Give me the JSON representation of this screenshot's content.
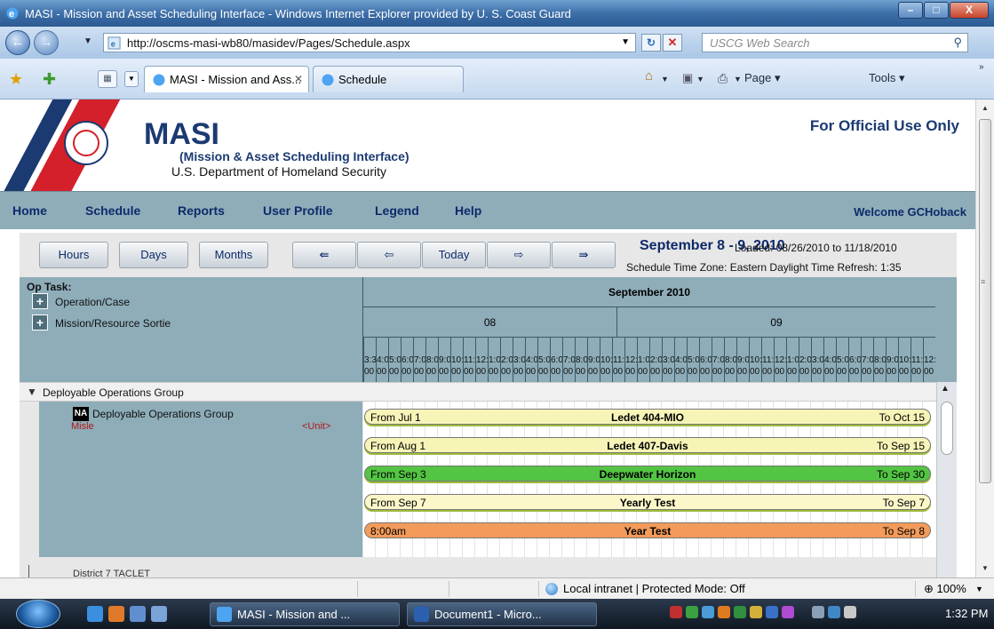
{
  "window": {
    "title": "MASI - Mission and Asset Scheduling Interface - Windows Internet Explorer provided by U. S. Coast Guard",
    "minimize": "–",
    "restore": "□",
    "close": "X"
  },
  "browser": {
    "url": "http://oscms-masi-wb80/masidev/Pages/Schedule.aspx",
    "search_placeholder": "USCG Web Search",
    "tabs": [
      {
        "label": "MASI - Mission and Ass...",
        "active": true
      },
      {
        "label": "Schedule",
        "active": false
      }
    ],
    "commands": {
      "page": "Page ▾",
      "tools": "Tools ▾"
    },
    "status_zone": "Local intranet | Protected Mode: Off",
    "zoom": "100%"
  },
  "page": {
    "brand": "MASI",
    "brand_subtitle": "(Mission & Asset Scheduling Interface)",
    "department": "U.S. Department of Homeland Security",
    "official_use": "For Official Use Only",
    "menu": [
      {
        "label": "Home"
      },
      {
        "label": "Schedule"
      },
      {
        "label": "Reports"
      },
      {
        "label": "User Profile"
      },
      {
        "label": "Legend"
      },
      {
        "label": "Help"
      }
    ],
    "welcome": "Welcome GCHoback"
  },
  "schedule": {
    "view_buttons": [
      "Hours",
      "Days",
      "Months"
    ],
    "nav_buttons": [
      "⇚",
      "⇦",
      "Today",
      "⇨",
      "⇛"
    ],
    "date_range_title": "September 8 - 9, 2010",
    "loaded_range": "Loaded: 08/26/2010 to 11/18/2010",
    "timezone_line": "Schedule Time Zone: Eastern Daylight Time   Refresh: 1:35",
    "op_task_label": "Op Task:",
    "legend": [
      {
        "icon": "+",
        "label": "Operation/Case"
      },
      {
        "icon": "+",
        "label": "Mission/Resource Sortie"
      }
    ],
    "month_label": "September 2010",
    "day_labels": [
      "08",
      "09"
    ],
    "hour_ticks": [
      "3:3",
      "4:0",
      "5:0",
      "6:0",
      "7:0",
      "8:0",
      "9:0",
      "10:",
      "11:",
      "12:",
      "1:0",
      "2:0",
      "3:0",
      "4:0",
      "5:0",
      "6:0",
      "7:0",
      "8:0",
      "9:0",
      "10:",
      "11:",
      "12:",
      "1:0",
      "2:0",
      "3:0",
      "4:0",
      "5:0",
      "6:0",
      "7:0",
      "8:0",
      "9:0",
      "10:",
      "11:",
      "12:",
      "1:0",
      "2:0",
      "3:0",
      "4:0",
      "5:0",
      "6:0",
      "7:0",
      "8:0",
      "9:0",
      "10:",
      "11:",
      "12:"
    ],
    "minute_label": "00",
    "group_name": "Deployable Operations Group",
    "unit": {
      "badge": "NA",
      "name": "Deployable Operations Group",
      "source": "Misle",
      "type": "<Unit>"
    },
    "events": [
      {
        "from": "From Jul 1",
        "name": "Ledet 404-MIO",
        "to": "To Oct 15",
        "color": "#f7f4b8"
      },
      {
        "from": "From Aug 1",
        "name": "Ledet 407-Davis",
        "to": "To Sep 15",
        "color": "#f7f4b8"
      },
      {
        "from": "From Sep 3",
        "name": "Deepwater Horizon",
        "to": "To Sep 30",
        "color": "#53c443"
      },
      {
        "from": "From Sep 7",
        "name": "Yearly Test",
        "to": "To Sep 7",
        "color": "#fbf7c9"
      },
      {
        "from": "8:00am",
        "name": "Year Test",
        "to": "To Sep 8",
        "color": "#f29b5a"
      }
    ],
    "next_group_partial": "District 7 TACLET"
  },
  "taskbar": {
    "buttons": [
      {
        "label": "MASI - Mission and ..."
      },
      {
        "label": "Document1 - Micro..."
      }
    ],
    "clock": "1:32 PM"
  }
}
